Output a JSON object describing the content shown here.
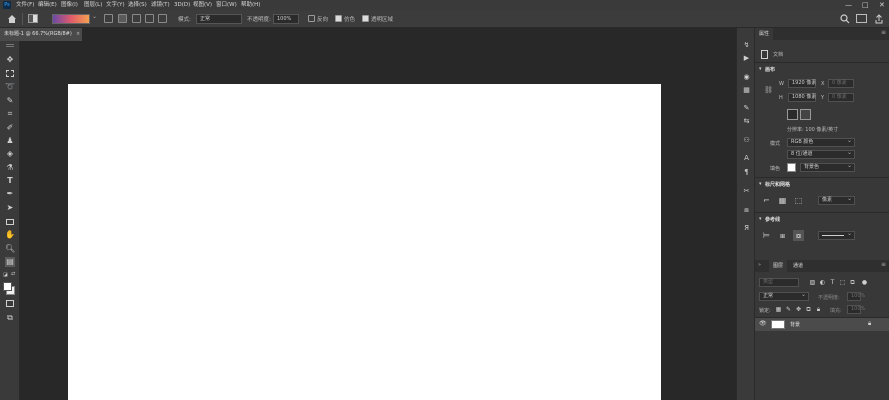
{
  "app": {
    "logo": "Ps"
  },
  "menubar": {
    "items": [
      "文件(F)",
      "编辑(E)",
      "图像(I)",
      "图层(L)",
      "文字(Y)",
      "选择(S)",
      "滤镜(T)",
      "3D(D)",
      "视图(V)",
      "窗口(W)",
      "帮助(H)"
    ],
    "window_controls": [
      "—",
      "□",
      "✕"
    ]
  },
  "options": {
    "mode_label": "模式:",
    "mode_value": "正常",
    "opacity_label": "不透明度:",
    "opacity_value": "100%",
    "reverse_label": "反向",
    "dither_label": "仿色",
    "transparency_label": "透明区域",
    "reverse_checked": false,
    "dither_checked": true,
    "transparency_checked": true
  },
  "document": {
    "tab_title": "未标题-1 @ 66.7%(RGB/8#)",
    "close_glyph": "×"
  },
  "properties": {
    "tab_label": "属性",
    "doc_label": "文档",
    "canvas_section": "画布",
    "width_label": "W",
    "width_value": "1920 像素",
    "height_label": "H",
    "height_value": "1080 像素",
    "x_label": "X",
    "x_placeholder": "0 像素",
    "y_label": "Y",
    "y_placeholder": "0 像素",
    "resolution": "分辨率: 100 像素/英寸",
    "mode_label": "模式",
    "mode_value": "RGB 颜色",
    "bitdepth_value": "8 位/通道",
    "fill_label": "填色",
    "fill_value": "背景色",
    "rulers_section": "标尺和网格",
    "rulers_unit": "像素",
    "guides_section": "参考线"
  },
  "layers": {
    "tab_layers": "图层",
    "tab_channels": "通道",
    "search_placeholder": "类型",
    "blend_mode": "正常",
    "opacity_label": "不透明度:",
    "opacity_value": "100%",
    "lock_label": "锁定:",
    "fill_label": "填充:",
    "fill_value": "100%",
    "background_layer_name": "背景"
  }
}
